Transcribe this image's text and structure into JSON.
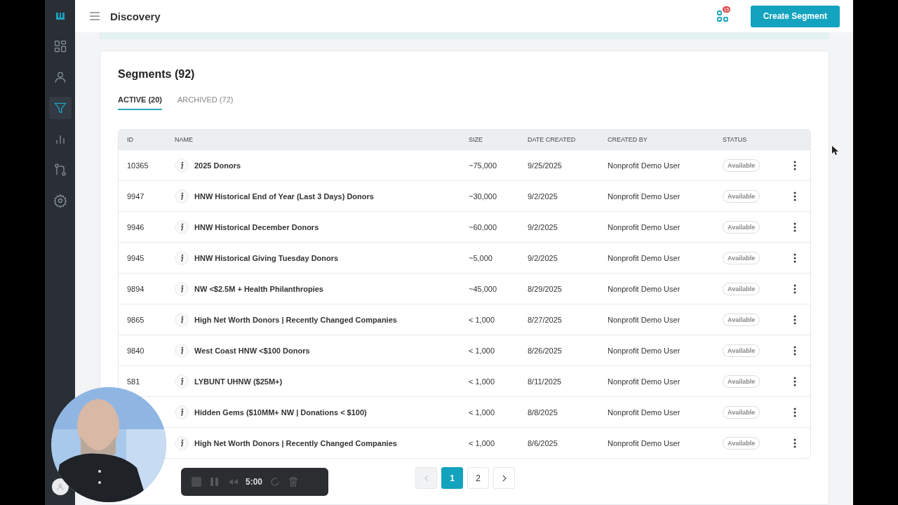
{
  "sidebar": {
    "items": [
      {
        "kind": "dashboard",
        "selected": false
      },
      {
        "kind": "person",
        "selected": false
      },
      {
        "kind": "filter",
        "selected": true
      },
      {
        "kind": "chart",
        "selected": false
      },
      {
        "kind": "flow",
        "selected": false
      },
      {
        "kind": "settings",
        "selected": false
      }
    ]
  },
  "header": {
    "title": "Discovery",
    "notification_count": "15",
    "action": "Create Segment"
  },
  "card": {
    "title": "Segments (92)",
    "tabs": [
      {
        "label": "ACTIVE (20)",
        "selected": true
      },
      {
        "label": "ARCHIVED (72)",
        "selected": false
      }
    ],
    "table": {
      "columns": [
        "ID",
        "NAME",
        "SIZE",
        "DATE CREATED",
        "CREATED BY",
        "STATUS"
      ],
      "rows": [
        {
          "id": "10365",
          "name": "2025 Donors",
          "size": "~75,000",
          "date": "9/25/2025",
          "created_by": "Nonprofit Demo User",
          "status": "Available"
        },
        {
          "id": "9947",
          "name": "HNW Historical End of Year (Last 3 Days) Donors",
          "size": "~30,000",
          "date": "9/2/2025",
          "created_by": "Nonprofit Demo User",
          "status": "Available"
        },
        {
          "id": "9946",
          "name": "HNW Historical December Donors",
          "size": "~60,000",
          "date": "9/2/2025",
          "created_by": "Nonprofit Demo User",
          "status": "Available"
        },
        {
          "id": "9945",
          "name": "HNW Historical Giving Tuesday Donors",
          "size": "~5,000",
          "date": "9/2/2025",
          "created_by": "Nonprofit Demo User",
          "status": "Available"
        },
        {
          "id": "9894",
          "name": "NW <$2.5M + Health Philanthropies",
          "size": "~45,000",
          "date": "8/29/2025",
          "created_by": "Nonprofit Demo User",
          "status": "Available"
        },
        {
          "id": "9865",
          "name": "High Net Worth Donors | Recently Changed Companies",
          "size": "< 1,000",
          "date": "8/27/2025",
          "created_by": "Nonprofit Demo User",
          "status": "Available"
        },
        {
          "id": "9840",
          "name": "West Coast HNW <$100 Donors",
          "size": "< 1,000",
          "date": "8/26/2025",
          "created_by": "Nonprofit Demo User",
          "status": "Available"
        },
        {
          "id": "581",
          "name": "LYBUNT UHNW ($25M+)",
          "size": "< 1,000",
          "date": "8/11/2025",
          "created_by": "Nonprofit Demo User",
          "status": "Available"
        },
        {
          "name": "Hidden Gems ($10MM+ NW | Donations < $100)",
          "size": "< 1,000",
          "date": "8/8/2025",
          "created_by": "Nonprofit Demo User",
          "status": "Available"
        },
        {
          "name": "High Net Worth Donors | Recently Changed Companies",
          "size": "< 1,000",
          "date": "8/6/2025",
          "created_by": "Nonprofit Demo User",
          "status": "Available"
        }
      ]
    },
    "pagination": {
      "prev_disabled": true,
      "pages": [
        {
          "label": "1",
          "selected": true
        },
        {
          "label": "2",
          "selected": false
        }
      ]
    }
  },
  "recorder": {
    "time": "5:00"
  }
}
